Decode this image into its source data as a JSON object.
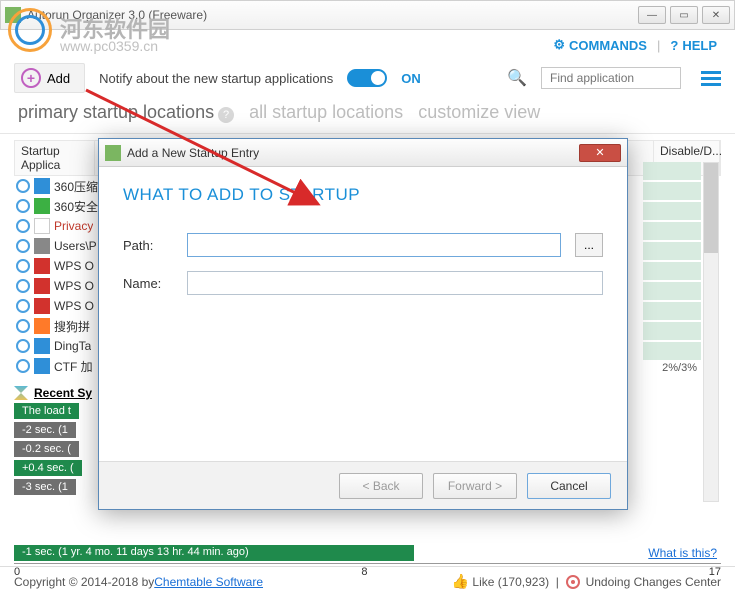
{
  "window": {
    "title": "Autorun Organizer 3.0 (Freeware)"
  },
  "watermark": {
    "text": "河东软件园",
    "url": "www.pc0359.cn"
  },
  "header": {
    "commands": "COMMANDS",
    "help": "HELP",
    "add": "Add",
    "notify": "Notify about the new startup applications",
    "on": "ON",
    "search_placeholder": "Find application"
  },
  "tabs": {
    "primary": "primary startup locations",
    "all": "all startup locations",
    "customize": "customize view"
  },
  "columns": {
    "c1": "Startup Applica",
    "c3": "Disable/D..."
  },
  "rows": [
    {
      "name": "360压缩",
      "color": "#333"
    },
    {
      "name": "360安全",
      "color": "#333"
    },
    {
      "name": "Privacy",
      "color": "#c0392b"
    },
    {
      "name": "Users\\P",
      "color": "#333"
    },
    {
      "name": "WPS O",
      "color": "#333"
    },
    {
      "name": "WPS O",
      "color": "#333"
    },
    {
      "name": "WPS O",
      "color": "#333"
    },
    {
      "name": "搜狗拼",
      "color": "#333"
    },
    {
      "name": "DingTa",
      "color": "#333"
    },
    {
      "name": "CTF 加",
      "color": "#333"
    }
  ],
  "percent": "2%/3%",
  "recent": {
    "heading": "Recent Sy",
    "items": [
      {
        "text": "The load t",
        "cls": ""
      },
      {
        "text": "-2 sec.  (1",
        "cls": "gr"
      },
      {
        "text": "-0.2 sec. (",
        "cls": "gr"
      },
      {
        "text": "+0.4 sec. (",
        "cls": ""
      },
      {
        "text": "-3 sec.  (1",
        "cls": "gr"
      }
    ]
  },
  "timeline": {
    "bar": "-1 sec. (1 yr. 4 mo. 11 days 13 hr. 44 min. ago)",
    "ticks": [
      "0",
      "8",
      "17"
    ]
  },
  "whatlink": "What is this?",
  "footer": {
    "copyright": "Copyright © 2014-2018 by ",
    "company": "Chemtable Software",
    "like": "Like (170,923)",
    "undoing": "Undoing Changes Center"
  },
  "dialog": {
    "title": "Add a New Startup Entry",
    "heading": "WHAT TO ADD TO STARTUP",
    "path_label": "Path:",
    "name_label": "Name:",
    "browse": "...",
    "back": "< Back",
    "forward": "Forward >",
    "cancel": "Cancel"
  }
}
